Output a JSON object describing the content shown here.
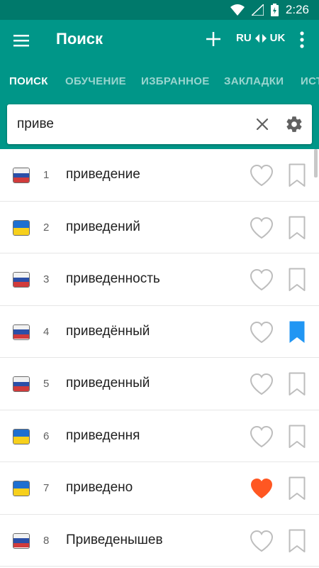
{
  "status_bar": {
    "time": "2:26"
  },
  "app_bar": {
    "title": "Поиск",
    "lang_from": "RU",
    "lang_to": "UK"
  },
  "tabs": [
    {
      "label": "ПОИСК",
      "active": true
    },
    {
      "label": "ОБУЧЕНИЕ",
      "active": false
    },
    {
      "label": "ИЗБРАННОЕ",
      "active": false
    },
    {
      "label": "ЗАКЛАДКИ",
      "active": false
    },
    {
      "label": "ИСТ",
      "active": false
    }
  ],
  "search": {
    "value": "приве"
  },
  "colors": {
    "primary": "#009688",
    "primary_dark": "#00796b",
    "bookmark_active": "#2196f3",
    "favorite_active": "#ff5722",
    "icon_inactive": "#bdbdbd"
  },
  "results": [
    {
      "index": "1",
      "word": "приведение",
      "flag": "ru-flag-icon",
      "favorite": false,
      "bookmark": false
    },
    {
      "index": "2",
      "word": "приведений",
      "flag": "ua-flag-icon",
      "favorite": false,
      "bookmark": false
    },
    {
      "index": "3",
      "word": "приведенность",
      "flag": "ru-flag-icon",
      "favorite": false,
      "bookmark": false
    },
    {
      "index": "4",
      "word": "приведённый",
      "flag": "ru-flag-icon",
      "favorite": false,
      "bookmark": true
    },
    {
      "index": "5",
      "word": "приведенный",
      "flag": "ru-flag-icon",
      "favorite": false,
      "bookmark": false
    },
    {
      "index": "6",
      "word": "приведення",
      "flag": "ua-flag-icon",
      "favorite": false,
      "bookmark": false
    },
    {
      "index": "7",
      "word": "приведено",
      "flag": "ua-flag-icon",
      "favorite": true,
      "bookmark": false
    },
    {
      "index": "8",
      "word": "Приведенышев",
      "flag": "ru-flag-icon",
      "favorite": false,
      "bookmark": false
    }
  ]
}
